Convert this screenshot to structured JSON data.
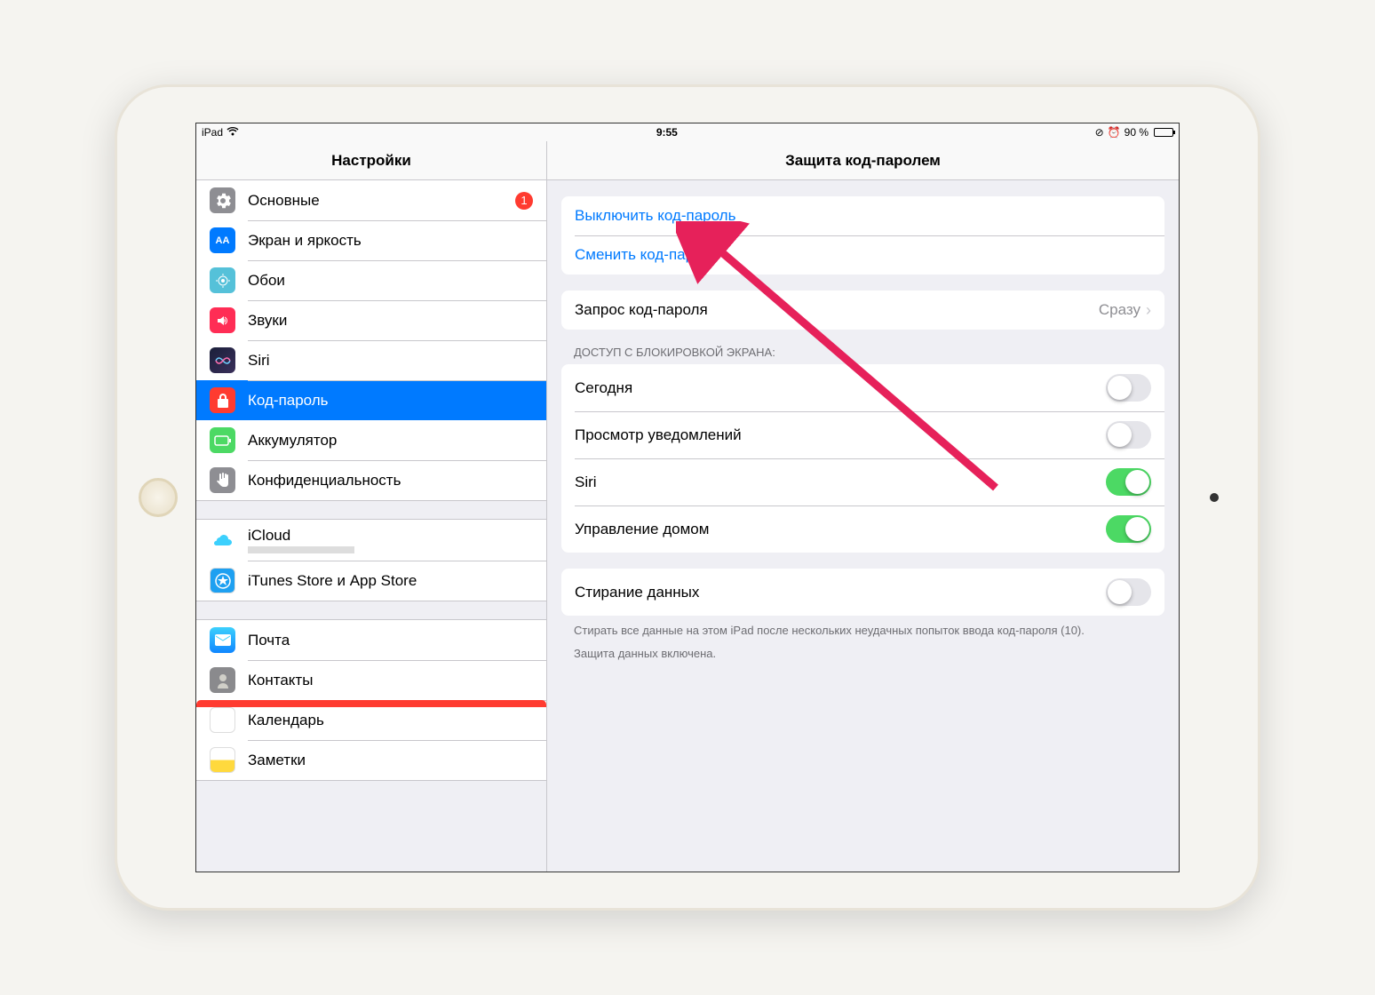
{
  "status": {
    "device": "iPad",
    "time": "9:55",
    "battery_pct": "90 %"
  },
  "header": {
    "left_title": "Настройки",
    "right_title": "Защита код-паролем"
  },
  "sidebar": {
    "group1": [
      {
        "label": "Основные",
        "badge": "1"
      },
      {
        "label": "Экран и яркость"
      },
      {
        "label": "Обои"
      },
      {
        "label": "Звуки"
      },
      {
        "label": "Siri"
      },
      {
        "label": "Код-пароль"
      },
      {
        "label": "Аккумулятор"
      },
      {
        "label": "Конфиденциальность"
      }
    ],
    "group2": [
      {
        "label": "iCloud"
      },
      {
        "label": "iTunes Store и App Store"
      }
    ],
    "group3": [
      {
        "label": "Почта"
      },
      {
        "label": "Контакты"
      },
      {
        "label": "Календарь"
      },
      {
        "label": "Заметки"
      }
    ]
  },
  "detail": {
    "turn_off": "Выключить код-пароль",
    "change": "Сменить код-пароль",
    "require_label": "Запрос код-пароля",
    "require_value": "Сразу",
    "lock_header": "ДОСТУП С БЛОКИРОВКОЙ ЭКРАНА:",
    "lock_items": [
      {
        "label": "Сегодня",
        "on": false
      },
      {
        "label": "Просмотр уведомлений",
        "on": false
      },
      {
        "label": "Siri",
        "on": true
      },
      {
        "label": "Управление домом",
        "on": true
      }
    ],
    "erase_label": "Стирание данных",
    "erase_on": false,
    "erase_footer": "Стирать все данные на этом iPad после нескольких неудачных попыток ввода код-пароля (10).",
    "protection_footer": "Защита данных включена."
  }
}
